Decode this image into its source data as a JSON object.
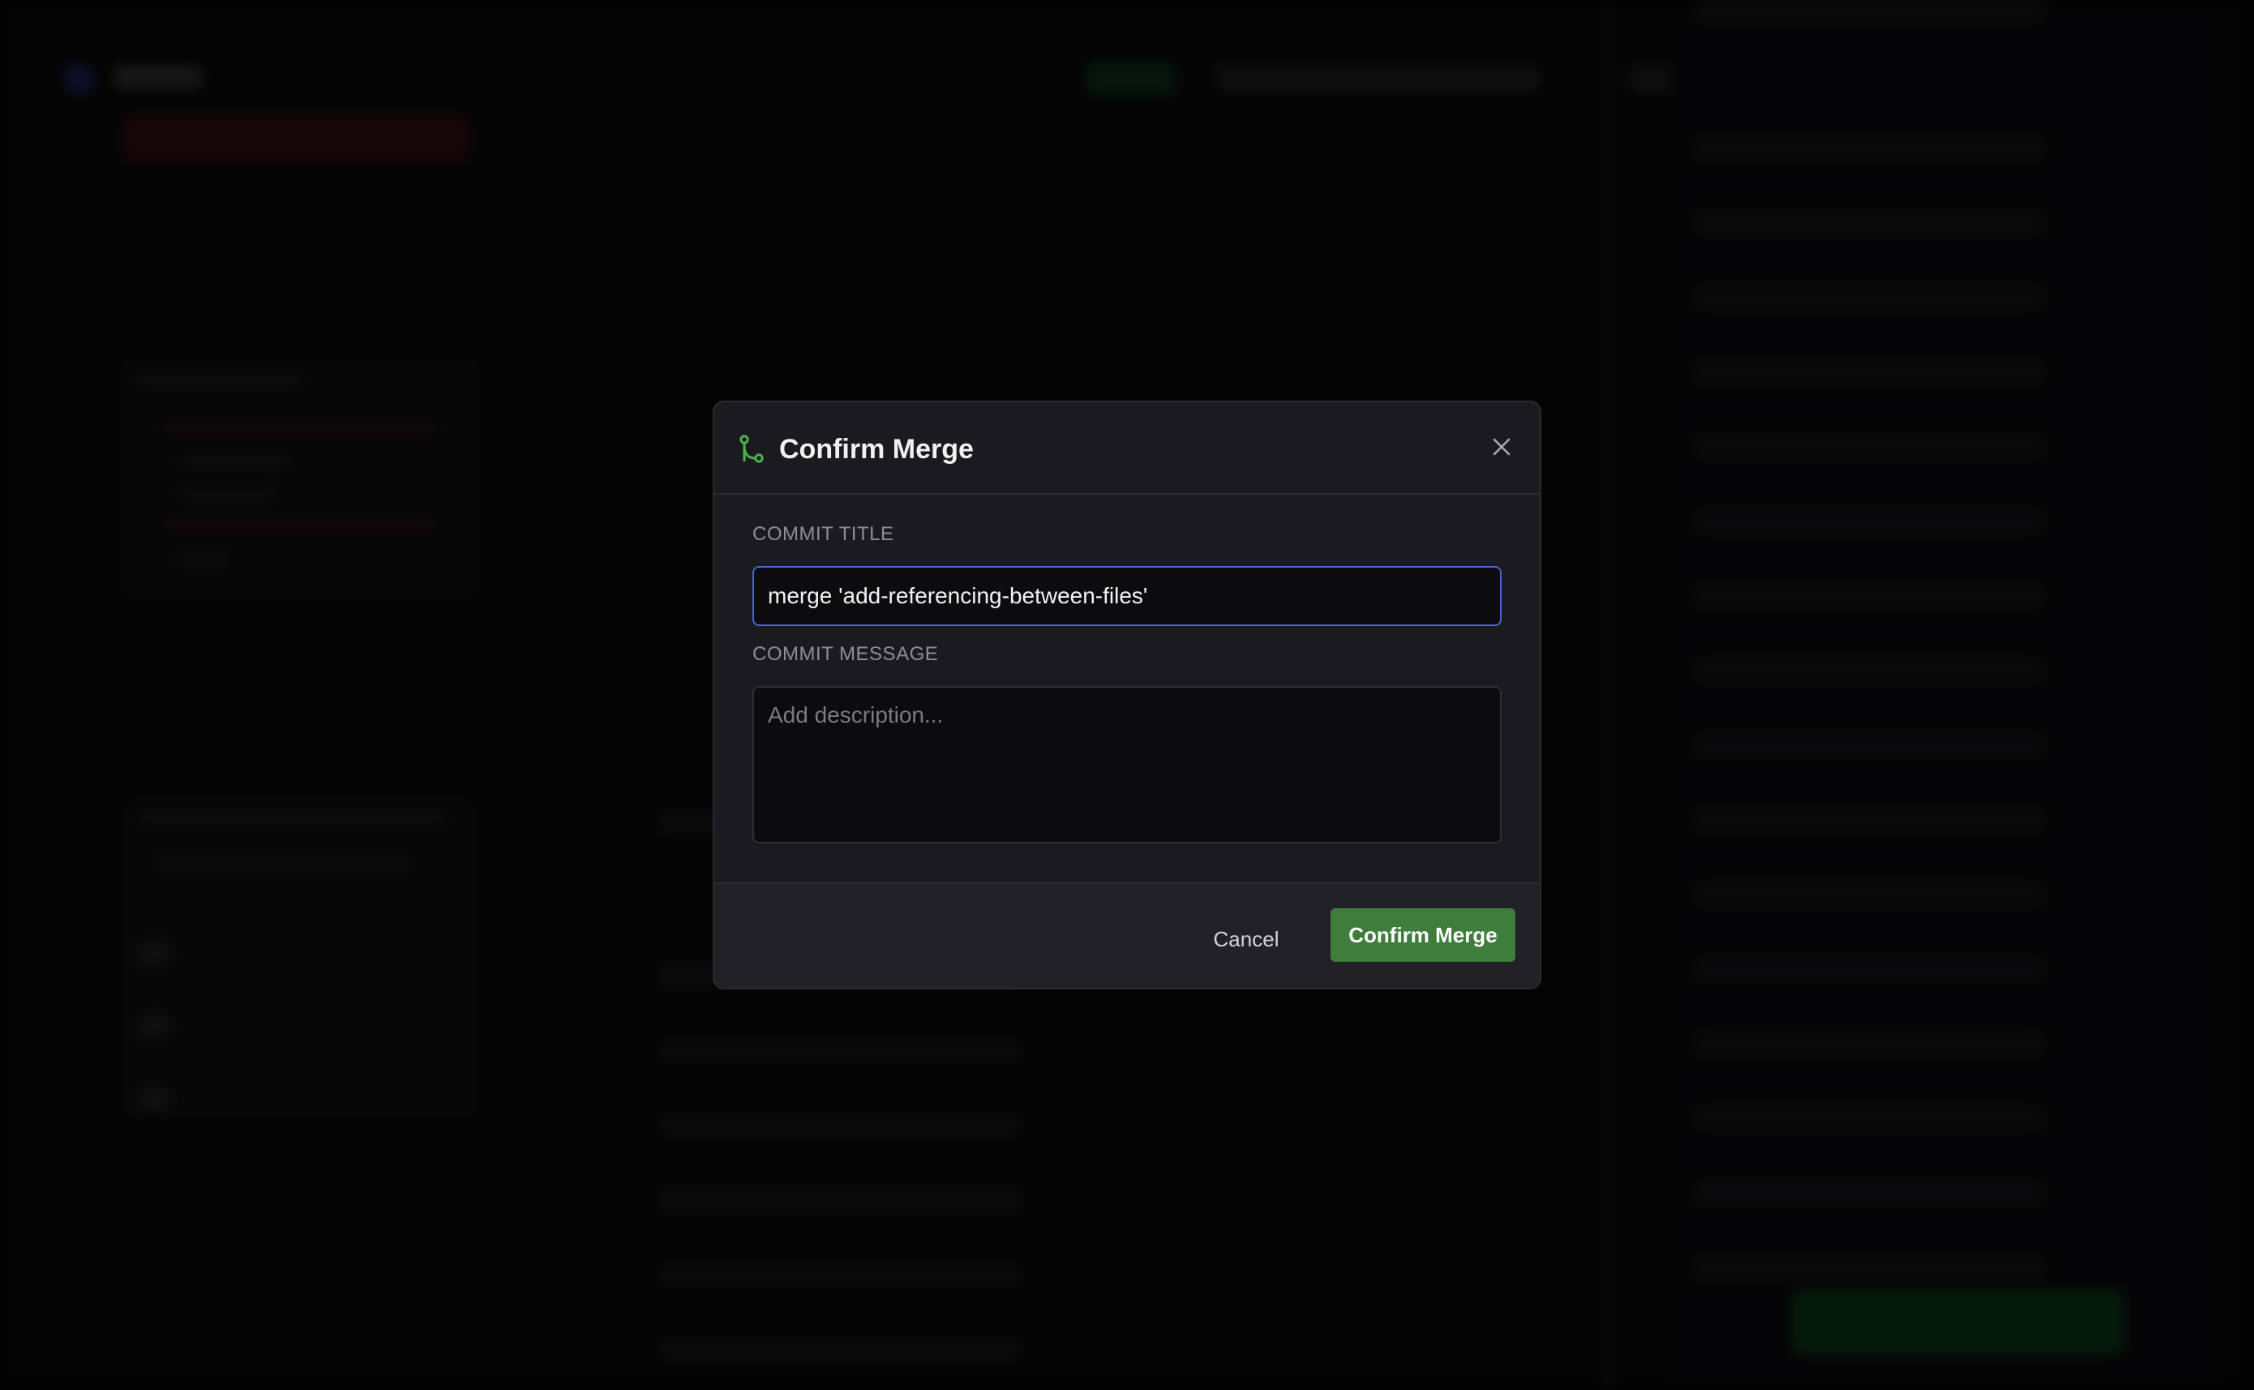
{
  "modal": {
    "title": "Confirm Merge",
    "icon": "git-merge-icon",
    "close_icon": "close-icon",
    "commit_title": {
      "label": "COMMIT TITLE",
      "value": "merge 'add-referencing-between-files'"
    },
    "commit_message": {
      "label": "COMMIT MESSAGE",
      "placeholder": "Add description...",
      "value": ""
    },
    "footer": {
      "cancel_label": "Cancel",
      "confirm_label": "Confirm Merge"
    }
  },
  "colors": {
    "accent_green": "#3e7d3c",
    "focus_blue": "#4a63d6",
    "modal_bg": "#1b1b1f",
    "icon_green": "#4caf50"
  }
}
